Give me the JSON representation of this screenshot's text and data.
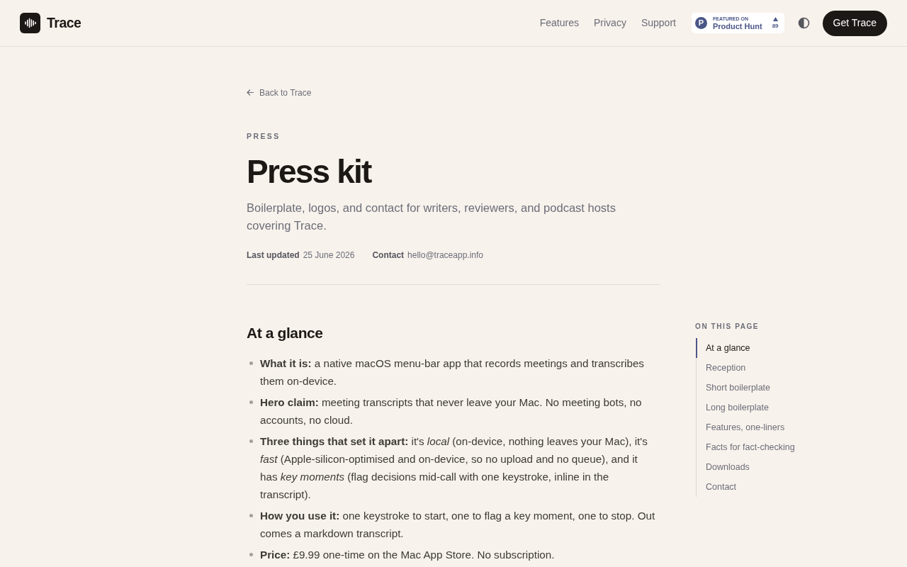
{
  "header": {
    "brand": "Trace",
    "nav": [
      "Features",
      "Privacy",
      "Support"
    ],
    "product_hunt": {
      "letter": "P",
      "eyebrow": "FEATURED ON",
      "name": "Product Hunt",
      "count": "89"
    },
    "cta": "Get Trace"
  },
  "back_link": "Back to Trace",
  "eyebrow": "PRESS",
  "title": "Press kit",
  "subtitle": "Boilerplate, logos, and contact for writers, reviewers, and podcast hosts covering Trace.",
  "meta": [
    {
      "label": "Last updated",
      "value": "25 June 2026"
    },
    {
      "label": "Contact",
      "value": "hello@traceapp.info"
    }
  ],
  "section": {
    "heading": "At a glance",
    "items": [
      "**What it is:** a native macOS menu-bar app that records meetings and transcribes them on-device.",
      "**Hero claim:** meeting transcripts that never leave your Mac. No meeting bots, no accounts, no cloud.",
      "**Three things that set it apart:** it's *local* (on-device, nothing leaves your Mac), it's *fast* (Apple-silicon-optimised and on-device, so no upload and no queue), and it has *key moments* (flag decisions mid-call with one keystroke, inline in the transcript).",
      "**How you use it:** one keystroke to start, one to flag a key moment, one to stop. Out comes a markdown transcript.",
      "**Price:** £9.99 one-time on the Mac App Store. No subscription."
    ]
  },
  "toc": {
    "heading": "ON THIS PAGE",
    "items": [
      {
        "label": "At a glance",
        "selected": true
      },
      {
        "label": "Reception",
        "selected": false
      },
      {
        "label": "Short boilerplate",
        "selected": false
      },
      {
        "label": "Long boilerplate",
        "selected": false
      },
      {
        "label": "Features, one-liners",
        "selected": false
      },
      {
        "label": "Facts for fact-checking",
        "selected": false
      },
      {
        "label": "Downloads",
        "selected": false
      },
      {
        "label": "Contact",
        "selected": false
      }
    ]
  }
}
